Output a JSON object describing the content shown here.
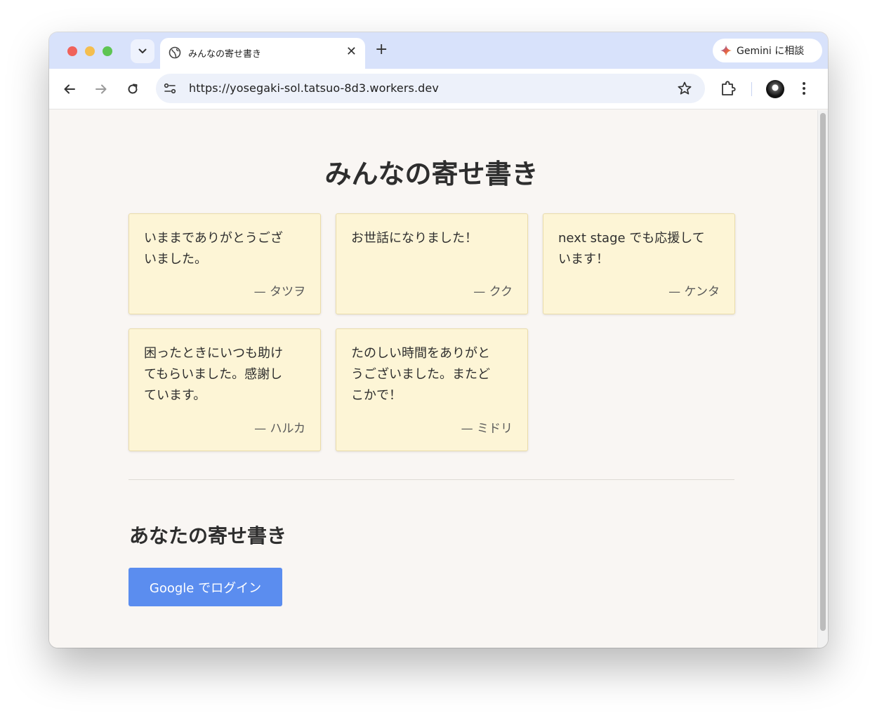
{
  "browser": {
    "tab_title": "みんなの寄せ書き",
    "url": "https://yosegaki-sol.tatsuo-8d3.workers.dev",
    "gemini_label": "Gemini に相談"
  },
  "page": {
    "title": "みんなの寄せ書き",
    "cards": [
      {
        "message": "いままでありがとうござ\nいました。",
        "author": "— タツヲ"
      },
      {
        "message": "お世話になりました！",
        "author": "— クク"
      },
      {
        "message": "next stage でも応援して\nいます！",
        "author": "— ケンタ"
      },
      {
        "message": "困ったときにいつも助け\nてもらいました。感謝し\nています。",
        "author": "— ハルカ"
      },
      {
        "message": "たのしい時間をありがと\nうございました。またど\nこかで！",
        "author": "— ミドリ"
      }
    ],
    "section_title": "あなたの寄せ書き",
    "login_button": "Google でログイン"
  }
}
